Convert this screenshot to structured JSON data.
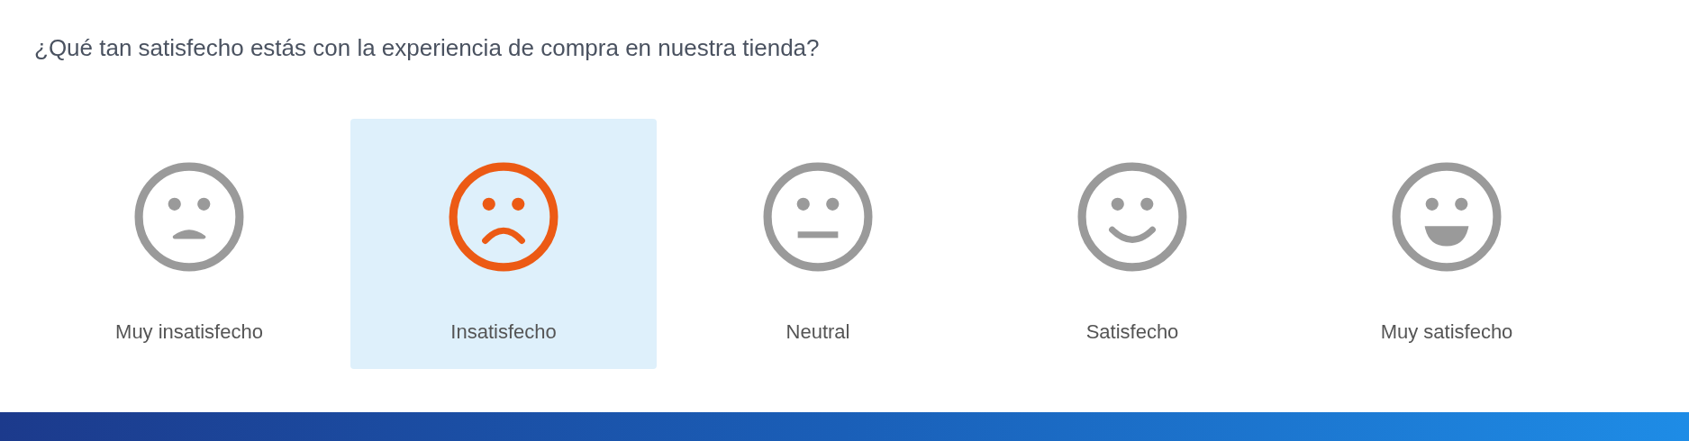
{
  "question": "¿Qué tan satisfecho estás con la experiencia de compra en nuestra tienda?",
  "options": [
    {
      "label": "Muy insatisfecho",
      "kind": "very-sad",
      "selected": false
    },
    {
      "label": "Insatisfecho",
      "kind": "sad",
      "selected": true
    },
    {
      "label": "Neutral",
      "kind": "neutral",
      "selected": false
    },
    {
      "label": "Satisfecho",
      "kind": "happy",
      "selected": false
    },
    {
      "label": "Muy satisfecho",
      "kind": "very-happy",
      "selected": false
    }
  ]
}
